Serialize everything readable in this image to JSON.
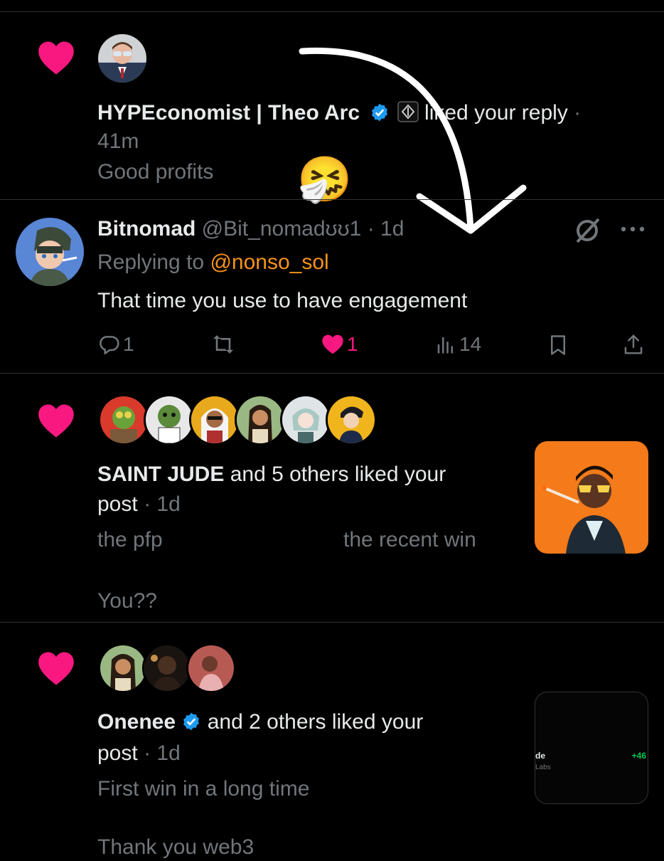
{
  "colors": {
    "accent_pink": "#f91880",
    "mention_orange": "#f7931a",
    "verified_blue": "#1d9bf0",
    "muted": "#71767b",
    "text": "#e7e9ea"
  },
  "notif1": {
    "name": "HYPEconomist | Theo Arc",
    "action": "liked your reply",
    "separator": "·",
    "time": "41m",
    "snippet": "Good profits",
    "emoji": "🤧"
  },
  "reply": {
    "name": "Bitnomad",
    "handle": "@Bit_nomadʊʊ1",
    "separator": "·",
    "time": "1d",
    "replying_prefix": "Replying to ",
    "replying_to": "@nonso_sol",
    "text": "That time you use to have engagement",
    "reply_count": "1",
    "like_count": "1",
    "views_count": "14"
  },
  "notif2": {
    "name": "SAINT JUDE",
    "rest": " and 5 others liked your",
    "line2": "post",
    "separator": "·",
    "time": "1d",
    "snippet_a": "the pfp",
    "snippet_b": "the recent win",
    "snippet_c": "You??"
  },
  "notif3": {
    "name": "Onenee",
    "rest": " and 2 others liked your",
    "line2": "post",
    "separator": "·",
    "time": "1d",
    "snippet_a": "First win in a long time",
    "snippet_b": "Thank you web3",
    "thumb_text_left": "de",
    "thumb_text_sub": "Labs",
    "thumb_text_right": "+46"
  }
}
